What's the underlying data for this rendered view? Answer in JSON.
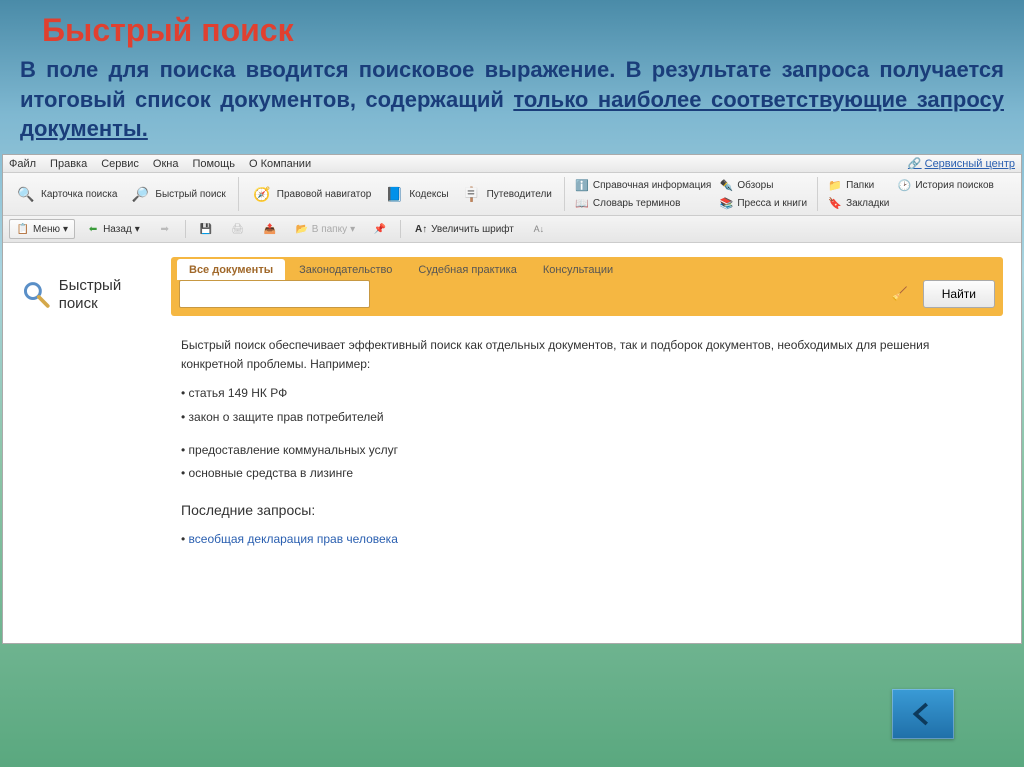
{
  "slide": {
    "title": "Быстрый поиск",
    "desc_plain": "В поле для поиска вводится поисковое выражение. В результате запроса получается итоговый список документов, содержащий ",
    "desc_under": "только наиболее соответствующие запросу документы."
  },
  "menu": {
    "items": [
      "Файл",
      "Правка",
      "Сервис",
      "Окна",
      "Помощь",
      "О Компании"
    ],
    "service_center": "Сервисный центр"
  },
  "toolbar": {
    "card_search": "Карточка поиска",
    "quick_search": "Быстрый поиск",
    "legal_nav": "Правовой навигатор",
    "codex": "Кодексы",
    "guides": "Путеводители",
    "ref_info": "Справочная информация",
    "reviews": "Обзоры",
    "dict": "Словарь терминов",
    "press": "Пресса и книги",
    "folders": "Папки",
    "history": "История поисков",
    "bookmarks": "Закладки"
  },
  "toolbar2": {
    "menu": "Меню",
    "back": "Назад",
    "to_folder": "В папку",
    "enlarge": "Увеличить шрифт"
  },
  "search": {
    "left_label": "Быстрый поиск",
    "tabs": [
      "Все документы",
      "Законодательство",
      "Судебная практика",
      "Консультации"
    ],
    "placeholder": "",
    "find_btn": "Найти"
  },
  "desc": {
    "intro": "Быстрый поиск обеспечивает эффективный поиск как отдельных документов, так и подборок документов, необходимых для решения конкретной проблемы. Например:",
    "examples": [
      "статья 149 НК РФ",
      "закон о защите прав потребителей",
      "предоставление коммунальных услуг",
      "основные средства в лизинге"
    ],
    "recent_title": "Последние запросы:",
    "recent_link": "всеобщая декларация прав человека"
  }
}
